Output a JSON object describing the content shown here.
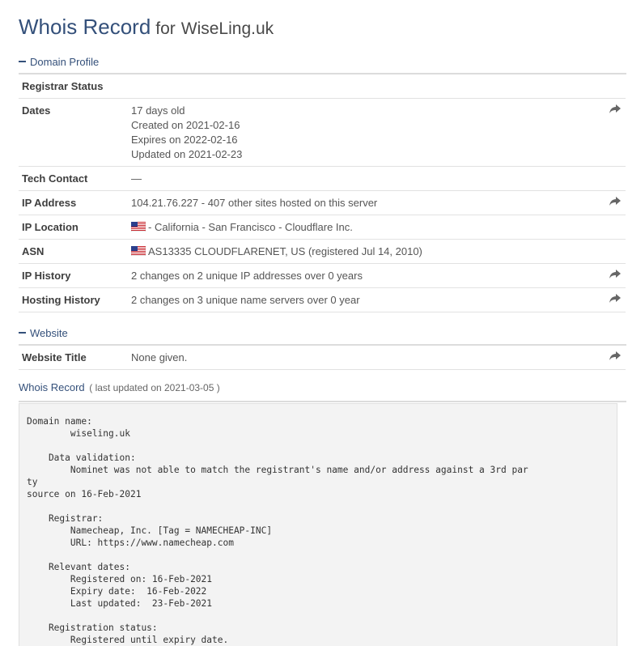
{
  "header": {
    "title": "Whois Record",
    "for_text": "for",
    "domain": "WiseLing.uk"
  },
  "domain_profile": {
    "heading": "Domain Profile",
    "rows": [
      {
        "label": "Registrar Status",
        "lines": [
          ""
        ],
        "share": false
      },
      {
        "label": "Dates",
        "lines": [
          "17 days old",
          "Created on 2021-02-16",
          "Expires on 2022-02-16",
          "Updated on 2021-02-23"
        ],
        "share": true
      },
      {
        "label": "Tech Contact",
        "lines": [
          "—"
        ],
        "share": false
      },
      {
        "label": "IP Address",
        "lines": [
          "104.21.76.227 - 407 other sites hosted on this server"
        ],
        "share": true
      },
      {
        "label": "IP Location",
        "lines": [
          "- California - San Francisco - Cloudflare Inc."
        ],
        "flag": true,
        "share": false
      },
      {
        "label": "ASN",
        "lines": [
          "AS13335 CLOUDFLARENET, US (registered Jul 14, 2010)"
        ],
        "flag": true,
        "share": false
      },
      {
        "label": "IP History",
        "lines": [
          "2 changes on 2 unique IP addresses over 0 years"
        ],
        "share": true
      },
      {
        "label": "Hosting History",
        "lines": [
          "2 changes on 3 unique name servers over 0 year"
        ],
        "share": true
      }
    ]
  },
  "website": {
    "heading": "Website",
    "rows": [
      {
        "label": "Website Title",
        "lines": [
          "None given."
        ],
        "share": true
      }
    ]
  },
  "whois_record": {
    "heading": "Whois Record",
    "updated": "( last updated on 2021-03-05 )",
    "raw": "Domain name:\n        wiseling.uk\n\n    Data validation:\n        Nominet was not able to match the registrant's name and/or address against a 3rd par\nty\nsource on 16-Feb-2021\n\n    Registrar:\n        Namecheap, Inc. [Tag = NAMECHEAP-INC]\n        URL: https://www.namecheap.com\n\n    Relevant dates:\n        Registered on: 16-Feb-2021\n        Expiry date:  16-Feb-2022\n        Last updated:  23-Feb-2021\n\n    Registration status:\n        Registered until expiry date."
  },
  "colors": {
    "accent": "#34507a",
    "border": "#dcdcdc",
    "raw_bg": "#f3f3f3"
  },
  "icons": {
    "share": "share-arrow-icon",
    "flag": "us-flag-icon",
    "collapse": "minus-icon"
  }
}
